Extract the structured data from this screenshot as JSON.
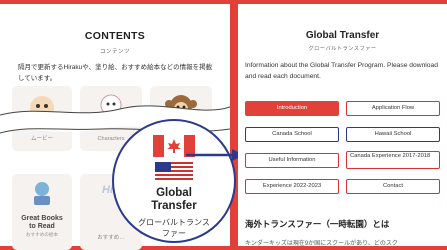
{
  "left": {
    "title": "CONTENTS",
    "subtitle": "コンテンツ",
    "description": "隔月で更新するHirakuや、塗り絵、おすすめ絵本などの情報を掲載しています。",
    "tiles": [
      {
        "label": "ムービー"
      },
      {
        "label": "Characters"
      },
      {
        "label": ""
      },
      {
        "label_line1": "Great Books",
        "label_line2": "to Read",
        "label_sub": "おすすめの絵本"
      },
      {
        "label_line1": "Hi",
        "label_sub": "おすすめ…"
      }
    ],
    "zoom": {
      "label_line1": "Global",
      "label_line2": "Transfer",
      "sub_line1": "グローバルトランス",
      "sub_line2": "ファー"
    }
  },
  "right": {
    "title": "Global Transfer",
    "subtitle": "グローバルトランスファー",
    "description": "Information about the Global Transfer Program. Please download and read each document.",
    "buttons": [
      {
        "label": "Introduction",
        "active": true
      },
      {
        "label": "Application Flow"
      },
      {
        "label": "Canada School"
      },
      {
        "label": "Hawaii School"
      },
      {
        "label": "Useful Information"
      },
      {
        "label": "Canada Experience 2017-2018"
      },
      {
        "label": "Experience 2022-2023"
      },
      {
        "label": "Contact"
      }
    ],
    "section_title": "海外トランスファー（一時転園）とは",
    "tail_text": "キンダーキッズは現在9か国にスクールがあり、どのスク"
  },
  "colors": {
    "brand_red": "#e2413a",
    "accent_blue": "#2d3a8c"
  }
}
